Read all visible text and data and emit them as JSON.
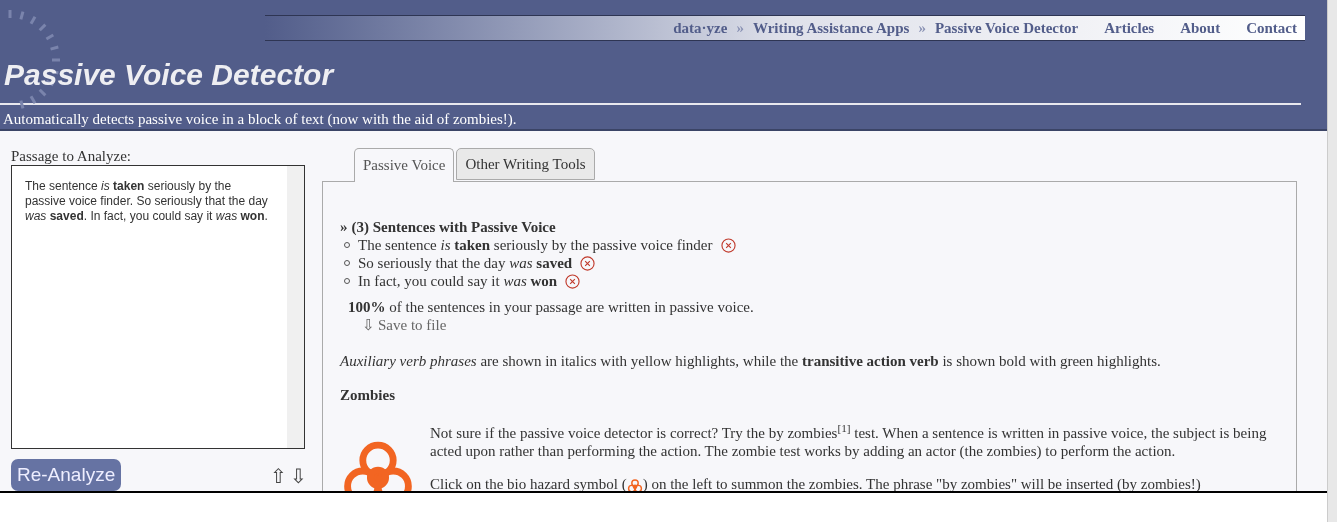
{
  "nav": {
    "breadcrumbs": [
      "data·yze",
      "Writing Assistance Apps",
      "Passive Voice Detector"
    ],
    "separator": "»",
    "links": [
      "Articles",
      "About",
      "Contact"
    ]
  },
  "header": {
    "title": "Passive Voice Detector",
    "subtitle": "Automatically detects passive voice in a block of text (now with the aid of zombies!)."
  },
  "passage": {
    "label": "Passage to Analyze:",
    "value": "The sentence *is* **taken** seriously by the passive voice finder.  So seriously that the day *was* **saved**.  In fact, you could say it *was* **won**.",
    "button": "Re-Analyze",
    "move_up": "⇧",
    "move_down": "⇩"
  },
  "tabs": [
    {
      "label": "Passive Voice",
      "selected": true
    },
    {
      "label": "Other Writing Tools",
      "selected": false
    }
  ],
  "results": {
    "heading_marker": "»",
    "heading": "(3) Sentences with Passive Voice",
    "sentences": [
      {
        "text": "The sentence *is* **taken** seriously by the passive voice finder"
      },
      {
        "text": "So seriously that the day *was* **saved**"
      },
      {
        "text": "In fact, you could say it *was* **won**"
      }
    ],
    "summary": "**100%** of the sentences in your passage are written in passive voice.",
    "save_icon": "⇩",
    "save": "Save to file",
    "legend": "*Auxiliary verb phrases* are shown in italics with yellow highlights, while the **transitive action verb** is shown bold with green highlights."
  },
  "zombies": {
    "heading": "Zombies",
    "paragraph_1": "Not sure if the passive voice detector is correct? Try the by zombies$^{[1]}$ test. When a sentence is written in passive voice, the subject is being acted upon rather than performing the action. The zombie test works by adding an actor (the zombies) to perform the action.",
    "paragraph_2_before": "Click on the bio hazard symbol (",
    "paragraph_2_after": ") on the left to summon the zombies. The phrase \"by zombies\" will be inserted (by zombies!)"
  }
}
